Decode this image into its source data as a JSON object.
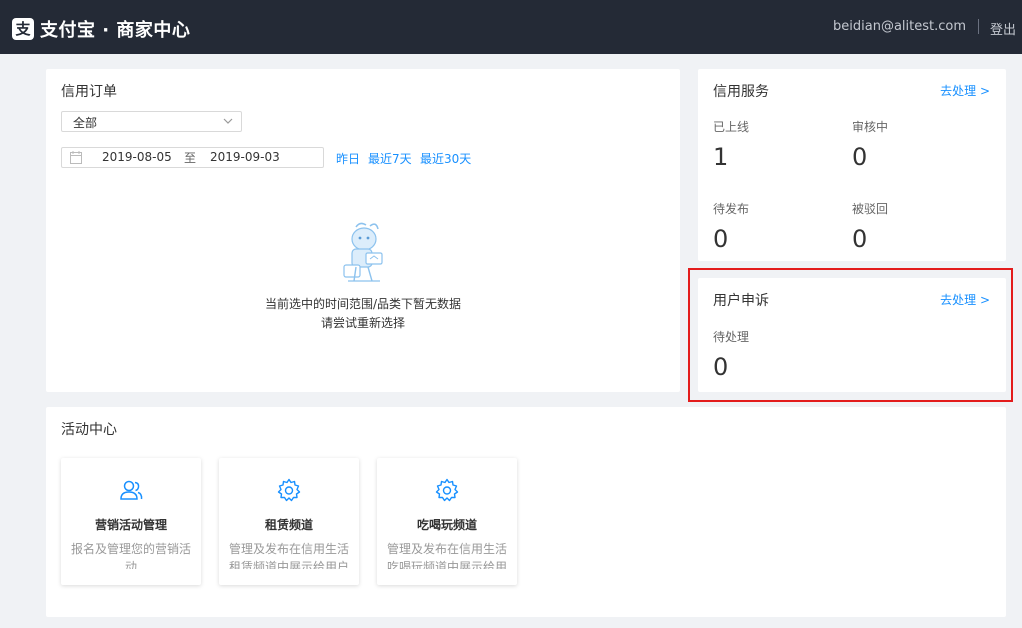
{
  "header": {
    "logo_char": "支",
    "brand": "支付宝 · 商家中心",
    "user_email": "beidian@alitest.com",
    "logout": "登出"
  },
  "orders": {
    "title": "信用订单",
    "filter_value": "全部",
    "date_start": "2019-08-05",
    "date_separator": "至",
    "date_end": "2019-09-03",
    "quick_links": [
      "昨日",
      "最近7天",
      "最近30天"
    ],
    "empty_line1": "当前选中的时间范围/品类下暂无数据",
    "empty_line2": "请尝试重新选择"
  },
  "service": {
    "title": "信用服务",
    "action": "去处理 >",
    "stats": [
      {
        "label": "已上线",
        "value": "1"
      },
      {
        "label": "审核中",
        "value": "0"
      },
      {
        "label": "待发布",
        "value": "0"
      },
      {
        "label": "被驳回",
        "value": "0"
      }
    ]
  },
  "complaint": {
    "title": "用户申诉",
    "action": "去处理 >",
    "stat": {
      "label": "待处理",
      "value": "0"
    }
  },
  "activity": {
    "title": "活动中心",
    "cards": [
      {
        "icon": "user-group-icon",
        "title": "营销活动管理",
        "desc": "报名及管理您的营销活动"
      },
      {
        "icon": "gear-icon",
        "title": "租赁频道",
        "desc": "管理及发布在信用生活租赁频道中展示给用户"
      },
      {
        "icon": "gear-icon",
        "title": "吃喝玩频道",
        "desc": "管理及发布在信用生活吃喝玩频道中展示给用户"
      }
    ]
  },
  "colors": {
    "header_bg": "#242a36",
    "link": "#1890ff",
    "highlight": "#e31c1c"
  }
}
